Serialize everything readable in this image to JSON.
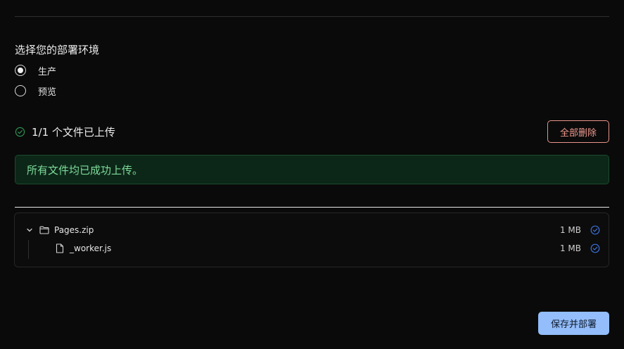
{
  "environment": {
    "heading": "选择您的部署环境",
    "options": [
      {
        "label": "生产",
        "selected": true
      },
      {
        "label": "预览",
        "selected": false
      }
    ]
  },
  "upload": {
    "status_text": "1/1 个文件已上传",
    "status_icon": "check-circle-icon",
    "delete_all_label": "全部删除",
    "success_message": "所有文件均已成功上传。"
  },
  "files": {
    "folder": {
      "name": "Pages.zip",
      "size": "1 MB",
      "icon": "folder-icon",
      "expanded": true
    },
    "children": [
      {
        "name": "_worker.js",
        "size": "1 MB",
        "icon": "file-icon"
      }
    ]
  },
  "actions": {
    "save_deploy_label": "保存并部署"
  },
  "colors": {
    "background": "#0a0a0a",
    "success_bg": "#0c2718",
    "success_text": "#7fdc9b",
    "danger": "#f19a8f",
    "primary": "#93bdfb",
    "check_blue": "#3b6fd6",
    "check_green": "#2e8f4f"
  }
}
